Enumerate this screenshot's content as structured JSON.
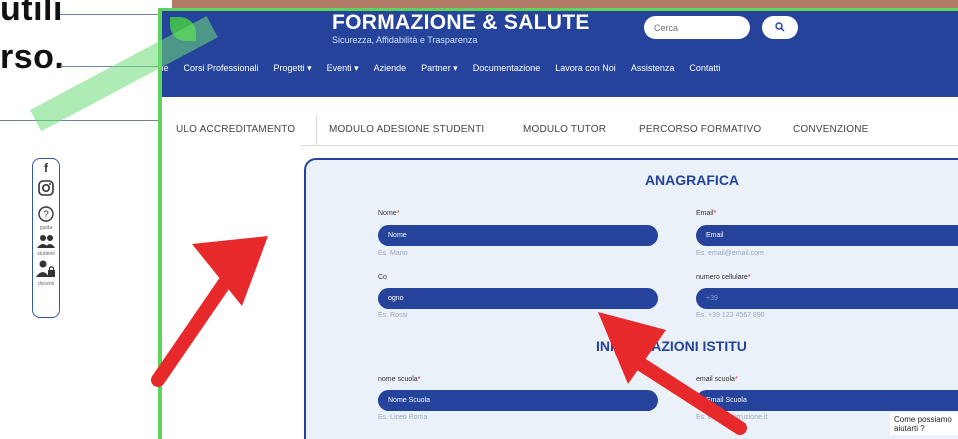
{
  "slide": {
    "text_line_1": "utili",
    "text_line_2": "rso."
  },
  "header": {
    "title": "FORMAZIONE & SALUTE",
    "subtitle": "Sicurezza, Affidabilità e Trasparenza",
    "search_placeholder": "Cerca",
    "search_icon": "search-icon"
  },
  "nav": {
    "items": [
      "me",
      "Corsi Professionali",
      "Progetti ▾",
      "Eventi ▾",
      "Aziende",
      "Partner ▾",
      "Documentazione",
      "Lavora con Noi",
      "Assistenza",
      "Contatti"
    ]
  },
  "tabs": [
    "ULO ACCREDITAMENTO",
    "MODULO ADESIONE STUDENTI",
    "MODULO TUTOR",
    "PERCORSO FORMATIVO",
    "CONVENZIONE"
  ],
  "social": {
    "items": [
      {
        "icon": "facebook-icon",
        "label": ""
      },
      {
        "icon": "instagram-icon",
        "label": ""
      },
      {
        "icon": "help-icon",
        "label": "guida"
      },
      {
        "icon": "users-icon",
        "label": "studenti"
      },
      {
        "icon": "user-lock-icon",
        "label": "docenti"
      }
    ]
  },
  "form": {
    "section_1": "ANAGRAFICA",
    "section_2": "INFORMAZIONI ISTITU",
    "fields": {
      "nome": {
        "label": "Nome",
        "value": "Nome",
        "hint": "Es. Mario"
      },
      "email": {
        "label": "Email",
        "value": "Email",
        "hint": "Es. email@email.com"
      },
      "cognome": {
        "label": "Co",
        "value": "ogno",
        "hint": "Es. Rossi"
      },
      "cellulare": {
        "label": "numero cellulare",
        "value": "+39",
        "hint": "Es. +39 123 4567 890"
      },
      "nome_scuola": {
        "label": "nome scuola",
        "value": "Nome Scuola",
        "hint": "Es. Liceo Roma"
      },
      "email_scuola": {
        "label": "email scuola",
        "value": "Email Scuola",
        "hint": "Es. email@istruzione.it"
      }
    },
    "required_mark": "*"
  },
  "chat": {
    "prompt": "Come possiamo aiutarti ?",
    "icon": "chat-icon",
    "top_icon": "chevrons-up-icon"
  },
  "colors": {
    "brand_blue": "#25439a",
    "accent_green": "#3fb64f",
    "arrow_red": "#e8292b"
  }
}
